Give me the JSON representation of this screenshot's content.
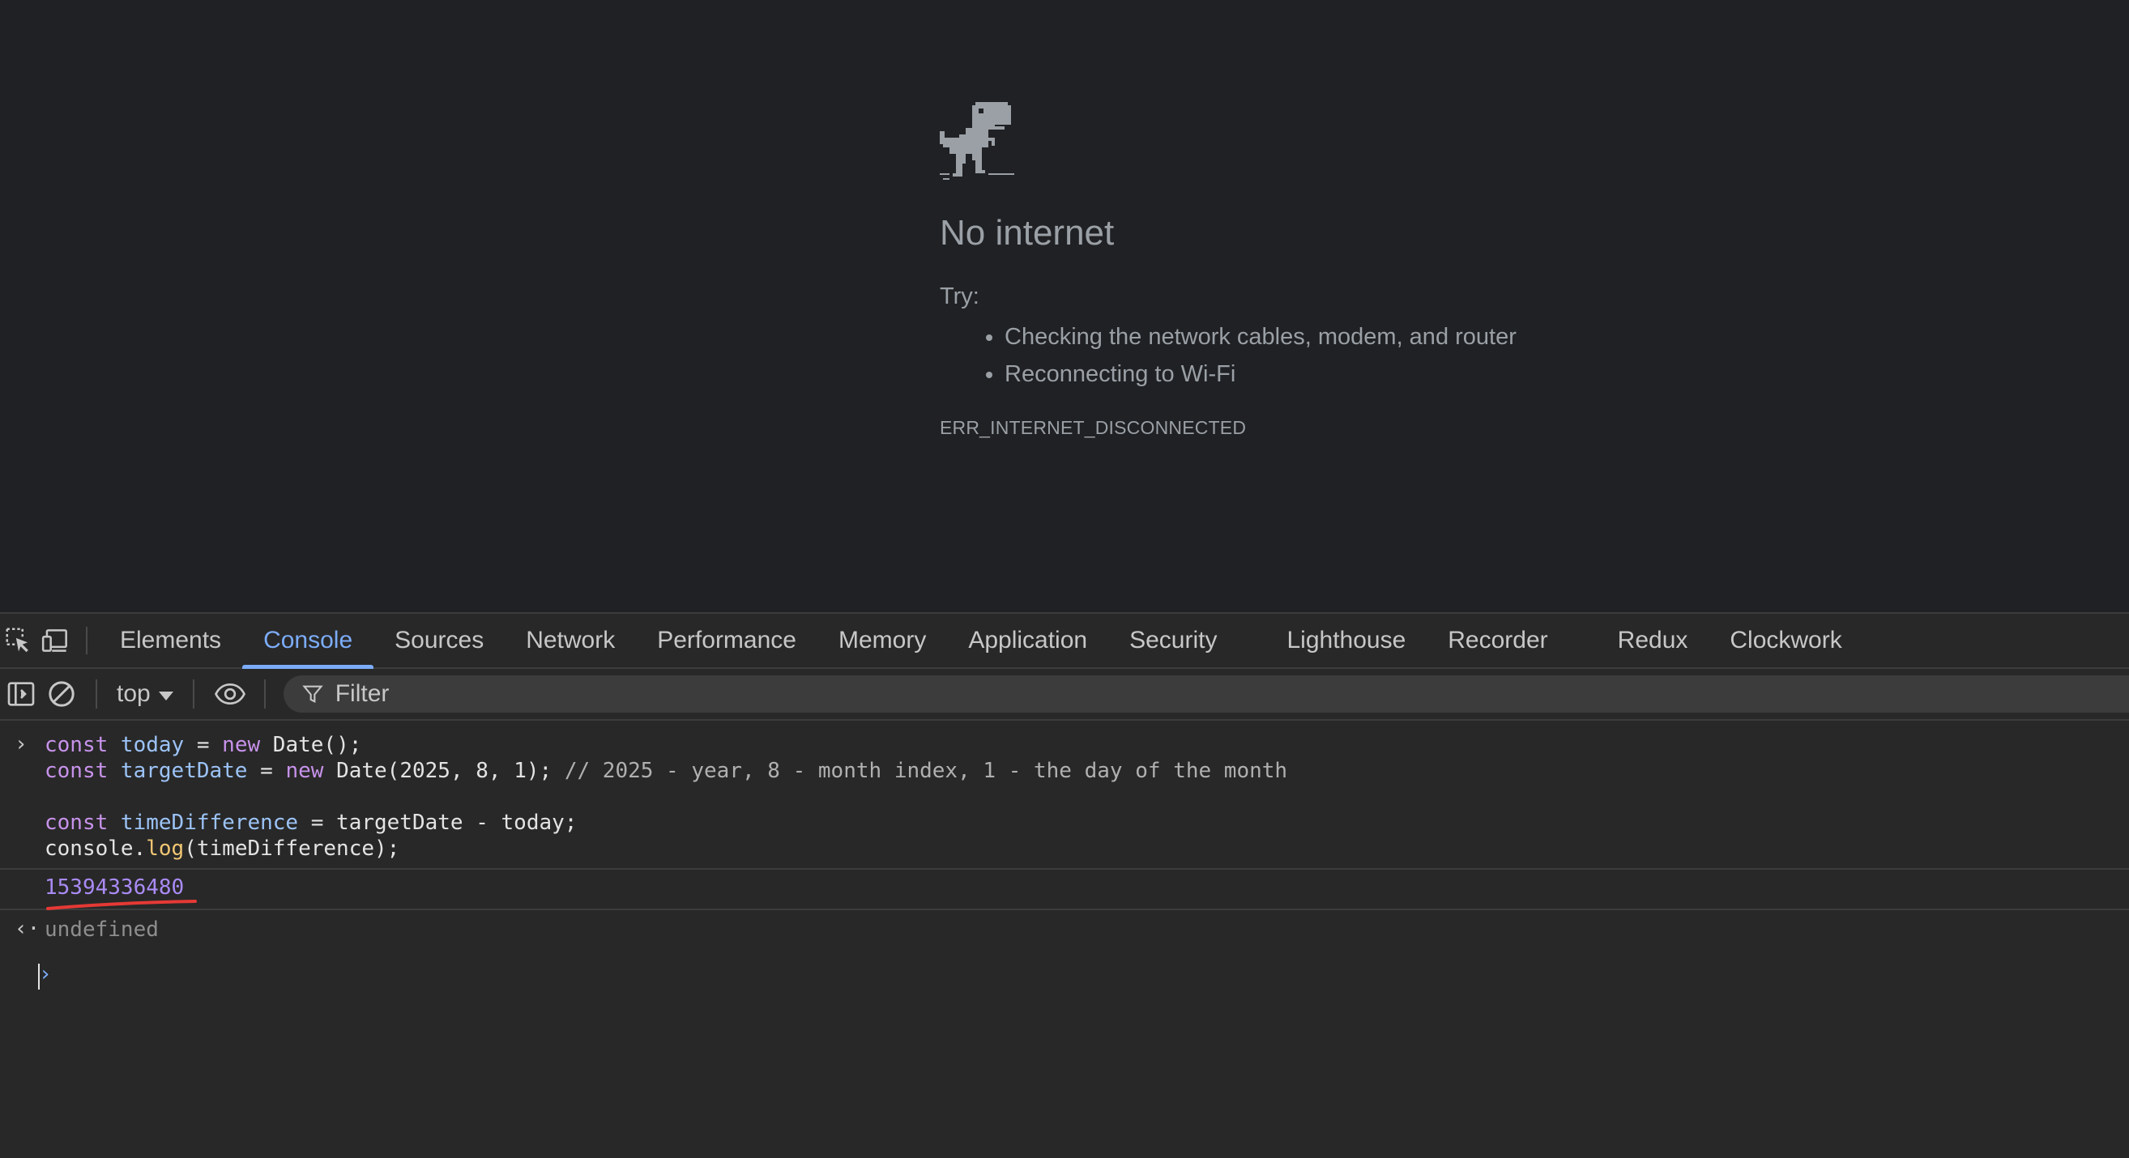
{
  "page": {
    "title": "No internet",
    "try_label": "Try:",
    "suggestions": [
      "Checking the network cables, modem, and router",
      "Reconnecting to Wi-Fi"
    ],
    "error_code": "ERR_INTERNET_DISCONNECTED"
  },
  "devtools": {
    "tabs": [
      "Elements",
      "Console",
      "Sources",
      "Network",
      "Performance",
      "Memory",
      "Application",
      "Security",
      "Lighthouse",
      "Recorder",
      "Redux",
      "Clockwork"
    ],
    "active_tab": "Console",
    "toolbar": {
      "context": "top",
      "filter_placeholder": "Filter"
    },
    "console": {
      "input_lines": [
        "const today = new Date();",
        "const targetDate = new Date(2025, 8, 1); // 2025 - year, 8 - month index, 1 - the day of the month",
        "",
        "const timeDifference = targetDate - today;",
        "console.log(timeDifference);"
      ],
      "log_output": "15394336480",
      "return_value": "undefined"
    }
  },
  "colors": {
    "page_bg": "#202124",
    "devtools_bg": "#282828",
    "accent": "#7cacf8",
    "log_number": "#a98bf5",
    "annotation": "#e53935"
  }
}
